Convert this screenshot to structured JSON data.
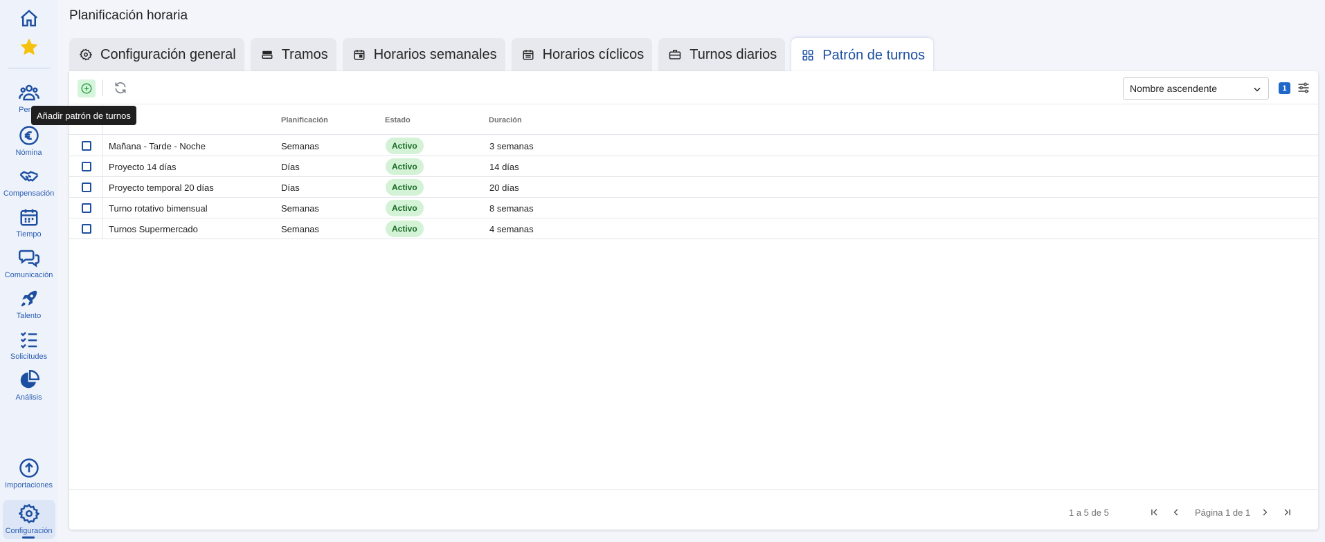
{
  "sidebar": {
    "items": [
      {
        "label": "",
        "icon": "home-icon"
      },
      {
        "label": "",
        "icon": "star-icon"
      },
      {
        "label": "Personas",
        "icon": "people-icon"
      },
      {
        "label": "Nómina",
        "icon": "euro-icon"
      },
      {
        "label": "Compensación",
        "icon": "handshake-icon"
      },
      {
        "label": "Tiempo",
        "icon": "calendar-icon"
      },
      {
        "label": "Comunicación",
        "icon": "chat-icon"
      },
      {
        "label": "Talento",
        "icon": "rocket-icon"
      },
      {
        "label": "Solicitudes",
        "icon": "checklist-icon"
      },
      {
        "label": "Análisis",
        "icon": "pie-chart-icon"
      },
      {
        "label": "Importaciones",
        "icon": "upload-icon"
      },
      {
        "label": "Configuración",
        "icon": "gear-icon"
      }
    ],
    "personas_visible": "Perso"
  },
  "header": {
    "title": "Planificación horaria"
  },
  "tabs": [
    {
      "label": "Configuración general",
      "icon": "gear-icon"
    },
    {
      "label": "Tramos",
      "icon": "layers-icon"
    },
    {
      "label": "Horarios semanales",
      "icon": "calendar-icon"
    },
    {
      "label": "Horarios cíclicos",
      "icon": "calendar-list-icon"
    },
    {
      "label": "Turnos diarios",
      "icon": "briefcase-icon"
    },
    {
      "label": "Patrón de turnos",
      "icon": "grid-icon",
      "active": true
    }
  ],
  "toolbar": {
    "add_tooltip": "Añadir patrón de turnos",
    "sort_value": "Nombre ascendente",
    "filter_count": "1"
  },
  "table": {
    "columns": [
      "Planificación",
      "Estado",
      "Duración"
    ],
    "rows": [
      {
        "name": "Mañana - Tarde - Noche",
        "planning": "Semanas",
        "status": "Activo",
        "duration": "3 semanas"
      },
      {
        "name": "Proyecto 14 días",
        "planning": "Días",
        "status": "Activo",
        "duration": "14 días"
      },
      {
        "name": "Proyecto temporal 20 días",
        "planning": "Días",
        "status": "Activo",
        "duration": "20 días"
      },
      {
        "name": "Turno rotativo bimensual",
        "planning": "Semanas",
        "status": "Activo",
        "duration": "8 semanas"
      },
      {
        "name": "Turnos Supermercado",
        "planning": "Semanas",
        "status": "Activo",
        "duration": "4 semanas"
      }
    ]
  },
  "pagination": {
    "range": "1 a 5 de 5",
    "page_label": "Página 1 de 1"
  },
  "colors": {
    "accent": "#1d4fa0",
    "status_bg": "#d3f2d6",
    "status_text": "#1a6a26",
    "add_bg": "#d6f5dd"
  }
}
